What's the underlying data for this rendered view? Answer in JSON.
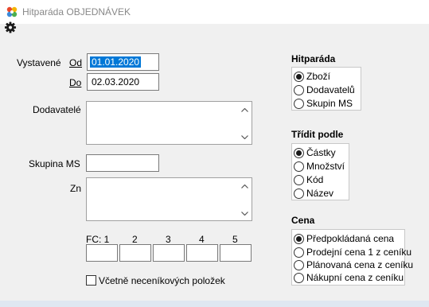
{
  "window": {
    "title": "Hitparáda OBJEDNÁVEK"
  },
  "form": {
    "vystavene_label": "Vystavené",
    "od_label": "Od",
    "od_value": "01.01.2020",
    "do_label": "Do",
    "do_value": "02.03.2020",
    "dodavatele_label": "Dodavatelé",
    "dodavatele_value": "",
    "skupina_label": "Skupina MS",
    "skupina_value": "",
    "zn_label": "Zn",
    "zn_value": "",
    "fc_labels": [
      "FC: 1",
      "2",
      "3",
      "4",
      "5"
    ],
    "fc_values": [
      "",
      "",
      "",
      "",
      ""
    ],
    "checkbox_label": "Včetně neceníkových položek",
    "checkbox_checked": false
  },
  "hitparada": {
    "title": "Hitparáda",
    "options": [
      "Zboží",
      "Dodavatelů",
      "Skupin MS"
    ],
    "selected": 0
  },
  "tridit": {
    "title": "Třídit podle",
    "options": [
      "Částky",
      "Množství",
      "Kód",
      "Název"
    ],
    "selected": 0
  },
  "cena": {
    "title": "Cena",
    "options": [
      "Předpokládaná cena",
      "Prodejní cena 1 z ceníku",
      "Plánovaná cena z ceníku",
      "Nákupní cena z ceníku"
    ],
    "selected": 0
  },
  "icons": {
    "app": "app-flower-icon",
    "settings": "gear-icon",
    "scroll_up": "chevron-up-icon",
    "scroll_down": "chevron-down-icon"
  },
  "colors": {
    "selection": "#0078d7",
    "title_text": "#888888"
  }
}
